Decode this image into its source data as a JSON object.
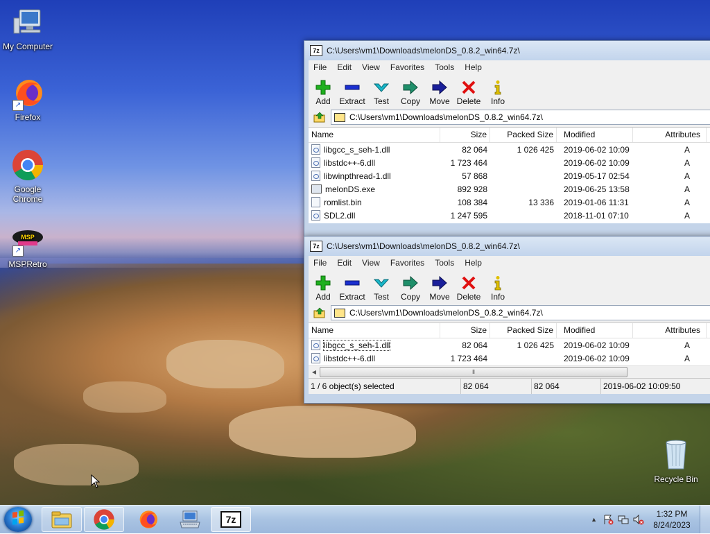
{
  "desktop": {
    "icons": [
      {
        "label": "My Computer",
        "icon": "computer-icon"
      },
      {
        "label": "Firefox",
        "icon": "firefox-icon"
      },
      {
        "label": "Google Chrome",
        "icon": "chrome-icon"
      },
      {
        "label": "MSPRetro",
        "icon": "msp-retro-icon"
      },
      {
        "label": "Recycle Bin",
        "icon": "recycle-bin-icon"
      }
    ]
  },
  "window_top": {
    "title": "C:\\Users\\vm1\\Downloads\\melonDS_0.8.2_win64.7z\\",
    "address": "C:\\Users\\vm1\\Downloads\\melonDS_0.8.2_win64.7z\\",
    "files": [
      {
        "name": "libgcc_s_seh-1.dll",
        "size": "82 064",
        "packed": "1 026 425",
        "modified": "2019-06-02 10:09",
        "attr": "A",
        "kind": "dll"
      },
      {
        "name": "libstdc++-6.dll",
        "size": "1 723 464",
        "packed": "",
        "modified": "2019-06-02 10:09",
        "attr": "A",
        "kind": "dll"
      },
      {
        "name": "libwinpthread-1.dll",
        "size": "57 868",
        "packed": "",
        "modified": "2019-05-17 02:54",
        "attr": "A",
        "kind": "dll"
      },
      {
        "name": "melonDS.exe",
        "size": "892 928",
        "packed": "",
        "modified": "2019-06-25 13:58",
        "attr": "A",
        "kind": "exe"
      },
      {
        "name": "romlist.bin",
        "size": "108 384",
        "packed": "13 336",
        "modified": "2019-01-06 11:31",
        "attr": "A",
        "kind": "bin"
      },
      {
        "name": "SDL2.dll",
        "size": "1 247 595",
        "packed": "",
        "modified": "2018-11-01 07:10",
        "attr": "A",
        "kind": "dll"
      }
    ]
  },
  "window_bottom": {
    "title": "C:\\Users\\vm1\\Downloads\\melonDS_0.8.2_win64.7z\\",
    "address": "C:\\Users\\vm1\\Downloads\\melonDS_0.8.2_win64.7z\\",
    "files": [
      {
        "name": "libgcc_s_seh-1.dll",
        "size": "82 064",
        "packed": "1 026 425",
        "modified": "2019-06-02 10:09",
        "attr": "A",
        "kind": "dll"
      },
      {
        "name": "libstdc++-6.dll",
        "size": "1 723 464",
        "packed": "",
        "modified": "2019-06-02 10:09",
        "attr": "A",
        "kind": "dll"
      }
    ],
    "status": {
      "selection": "1 / 6 object(s) selected",
      "size": "82 064",
      "packed": "82 064",
      "modified": "2019-06-02 10:09:50"
    }
  },
  "menu": [
    "File",
    "Edit",
    "View",
    "Favorites",
    "Tools",
    "Help"
  ],
  "toolbar": [
    {
      "label": "Add",
      "icon": "add-icon",
      "color": "#1fb01f"
    },
    {
      "label": "Extract",
      "icon": "extract-icon",
      "color": "#1a2fd0"
    },
    {
      "label": "Test",
      "icon": "test-icon",
      "color": "#19b6c8"
    },
    {
      "label": "Copy",
      "icon": "copy-icon",
      "color": "#1f8f6a"
    },
    {
      "label": "Move",
      "icon": "move-icon",
      "color": "#1a1f9a"
    },
    {
      "label": "Delete",
      "icon": "delete-icon",
      "color": "#e01010"
    },
    {
      "label": "Info",
      "icon": "info-icon",
      "color": "#e0c000"
    }
  ],
  "columns": {
    "name": "Name",
    "size": "Size",
    "packed": "Packed Size",
    "modified": "Modified",
    "attributes": "Attributes"
  },
  "taskbar": {
    "apps": [
      "explorer-icon",
      "chrome-icon",
      "firefox-icon",
      "keyboard-app-icon",
      "7zip-icon"
    ],
    "app_7z_label": "7z",
    "clock_time": "1:32 PM",
    "clock_date": "8/24/2023"
  }
}
